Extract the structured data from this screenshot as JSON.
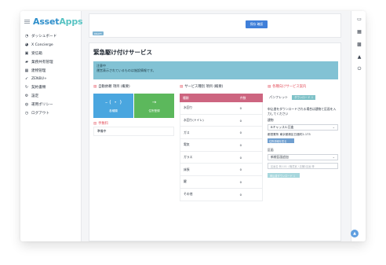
{
  "app": {
    "logo_asset": "Asset",
    "logo_apps": "Apps"
  },
  "sidebar": {
    "items": [
      {
        "label": "ダッシュボード",
        "icon": "speedometer-icon"
      },
      {
        "label": "X Concierge",
        "icon": "chat-icon"
      },
      {
        "label": "受信箱",
        "icon": "inbox-icon"
      },
      {
        "label": "業務共有管理",
        "icon": "folder-icon"
      },
      {
        "label": "建物管理",
        "icon": "building-icon"
      },
      {
        "label": "ZENBU+",
        "icon": "send-icon"
      },
      {
        "label": "契約書類",
        "icon": "refresh-icon"
      },
      {
        "label": "設定",
        "icon": "gear-icon"
      },
      {
        "label": "運用ポリシー",
        "icon": "globe-icon"
      },
      {
        "label": "ログアウト",
        "icon": "logout-icon"
      }
    ]
  },
  "topbar": {
    "save_label": "保存 確認",
    "tag_label": "DRAFT"
  },
  "page": {
    "title": "緊急駆け付けサービス",
    "notice_line1": "注意中",
    "notice_line2": "運営表示されているものは施設情報です。"
  },
  "columns": {
    "col1_title": "自動依頼 項目 (概要)",
    "col2_title": "サービス種別 項目 (概要)",
    "col3_title": "各種向けサービス案内"
  },
  "actions": {
    "btn1_symbol": "– ( ・ )",
    "btn1_label": "各種類",
    "btn2_symbol": "→",
    "btn2_label": "住所登録",
    "btn1_color": "#4aa6df",
    "btn2_color": "#5cb85c"
  },
  "fees": {
    "heading": "手数料",
    "row": "準備中"
  },
  "services": {
    "header": [
      "種類",
      "件数"
    ],
    "rows": [
      {
        "name": "水回り",
        "count": "0"
      },
      {
        "name": "水回り(トイレ)",
        "count": "0"
      },
      {
        "name": "ガス",
        "count": "0"
      },
      {
        "name": "電気",
        "count": "0"
      },
      {
        "name": "ガラス",
        "count": "0"
      },
      {
        "name": "床張",
        "count": "0"
      },
      {
        "name": "鍵",
        "count": "0"
      },
      {
        "name": "その他",
        "count": "0"
      }
    ]
  },
  "guide": {
    "pamphlet_label": "パンフレット",
    "download_label": "ダウンロード ⇩",
    "note": "申込書をダウンロードされる場合は建物と区画を入力してください",
    "building_label": "建物",
    "building_value": "Bキャッスル日進",
    "address": "都営業所 東京都港区日進町2-173",
    "address_button": "住所詳細を見る",
    "section_label": "区画",
    "section_value": "新規区画追加",
    "input_placeholder": "区画名 例:101 / 職員室 / 店舗1区画 等",
    "download_button": "申込書ダウンロード ⇩"
  },
  "rightbar": {
    "icons": [
      "mail-icon",
      "calendar-icon",
      "grid-icon",
      "warning-icon",
      "power-icon"
    ]
  }
}
